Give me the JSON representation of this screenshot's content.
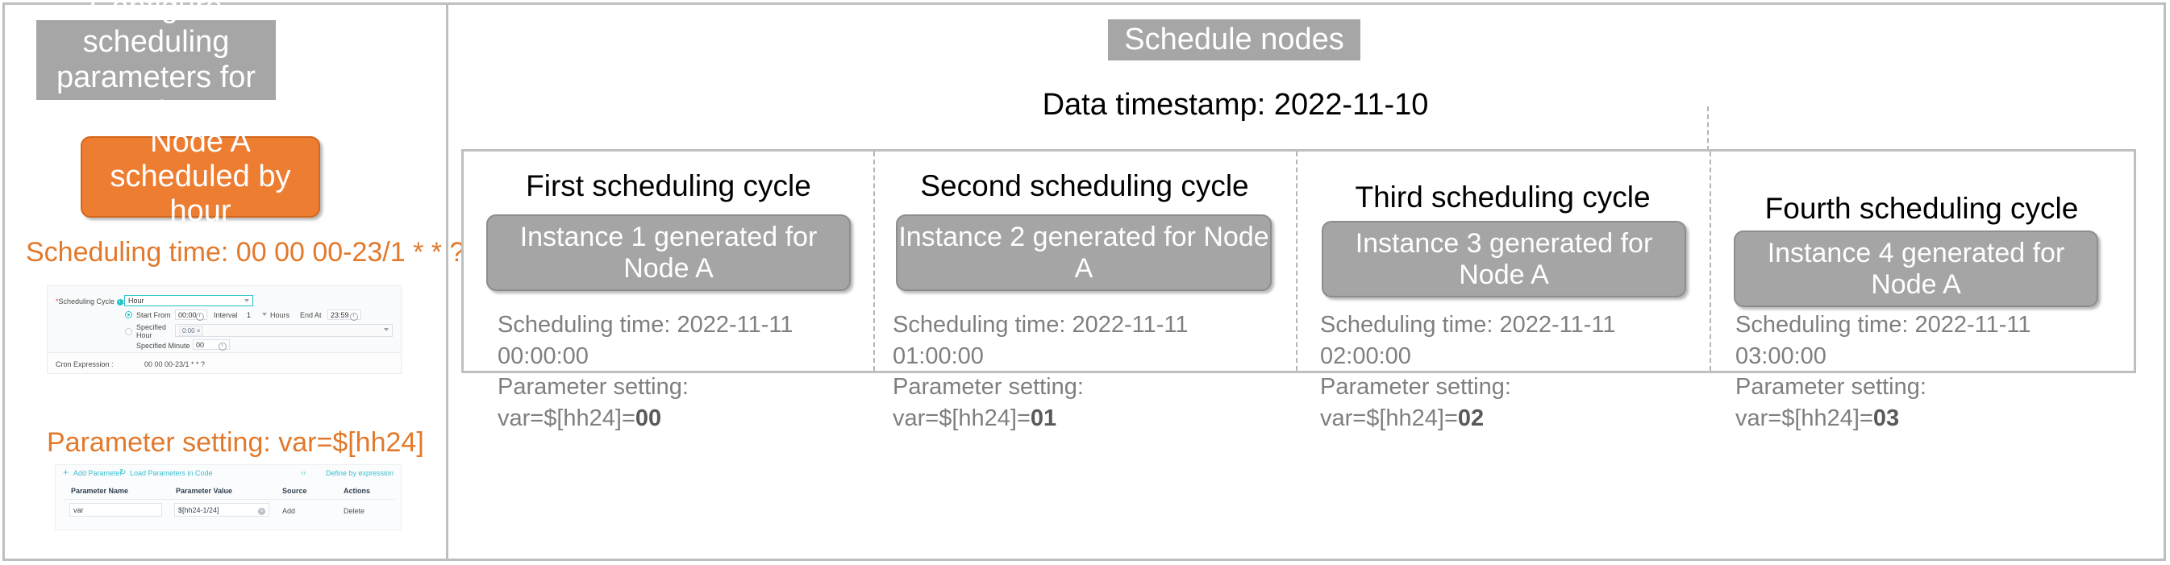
{
  "left": {
    "title": "Configure scheduling parameters for nodes",
    "node_box": "Node A scheduled by hour",
    "scheduling_time_caption": "Scheduling time: 00 00 00-23/1 * * ?",
    "parameter_setting_caption": "Parameter setting: var=$[hh24]",
    "cron_form": {
      "scheduling_cycle_label": "Scheduling Cycle",
      "required_mark": "*",
      "info_icon": "i",
      "colon": ":",
      "cycle_value": "Hour",
      "start_from_label": "Start From",
      "start_from_value": "00:00",
      "interval_label": "Interval",
      "interval_value": "1",
      "hours_label": "Hours",
      "end_at_label": "End At",
      "end_at_value": "23:59",
      "specified_hour_label": "Specified Hour",
      "specified_hour_chip": "0:00",
      "chip_close": "×",
      "specified_minute_label": "Specified Minute",
      "specified_minute_value": "00",
      "cron_expression_label": "Cron Expression :",
      "cron_expression_value": "00 00 00-23/1 * * ?"
    },
    "param_table": {
      "add_parameter": "Add Parameter",
      "plus_icon": "+",
      "refresh_icon": "↻",
      "load_parameters": "Load Parameters in Code",
      "expression_icon": "‹›",
      "define_by_expression": "Define by expression",
      "columns": [
        "Parameter Name",
        "Parameter Value",
        "Source",
        "Actions"
      ],
      "row": {
        "name": "var",
        "value": "$[hh24-1/24]",
        "clear_icon": "×",
        "source": "Add",
        "action": "Delete"
      }
    }
  },
  "right": {
    "banner": "Schedule nodes",
    "data_timestamp": "Data timestamp: 2022-11-10",
    "cycles": [
      {
        "title": "First scheduling cycle",
        "instance": "Instance 1 generated for Node A",
        "scheduling_time": "Scheduling time: 2022-11-11 00:00:00",
        "parameter_label": "Parameter setting:",
        "parameter_expr": "var=$[hh24]=",
        "parameter_value": "00"
      },
      {
        "title": "Second scheduling cycle",
        "instance": "Instance 2 generated for Node A",
        "scheduling_time": "Scheduling time: 2022-11-11 01:00:00",
        "parameter_label": "Parameter setting:",
        "parameter_expr": "var=$[hh24]=",
        "parameter_value": "01"
      },
      {
        "title": "Third scheduling cycle",
        "instance": "Instance 3 generated for Node A",
        "scheduling_time": "Scheduling time: 2022-11-11 02:00:00",
        "parameter_label": "Parameter setting:",
        "parameter_expr": "var=$[hh24]=",
        "parameter_value": "02"
      },
      {
        "title": "Fourth scheduling cycle",
        "instance": "Instance 4 generated for Node A",
        "scheduling_time": "Scheduling time: 2022-11-11 03:00:00",
        "parameter_label": "Parameter setting:",
        "parameter_expr": "var=$[hh24]=",
        "parameter_value": "03"
      }
    ]
  },
  "colors": {
    "orange": "#ED7D31",
    "grey_banner": "#A6A6A6",
    "instance_grey": "#A5A5A5",
    "detail_text": "#7F7F7F",
    "border_grey": "#BFBFBF",
    "console_accent": "#3AC0CE"
  }
}
